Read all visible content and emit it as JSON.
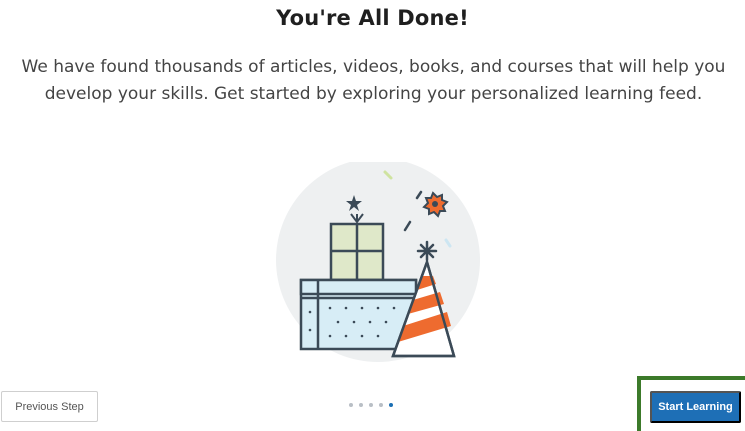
{
  "heading": {
    "title": "You're All Done!",
    "description": "We have found thousands of articles, videos, books, and courses that will help you develop your skills. Get started by exploring your personalized learning feed."
  },
  "illustration": {
    "icon": "celebration-illustration",
    "colors": {
      "circle": "#eef0f1",
      "gift_green": "#dfe8c9",
      "gift_blue": "#d7edf6",
      "party_hat_stripe": "#ee6b2f",
      "outline": "#3b4a57"
    }
  },
  "footer": {
    "previous_label": "Previous Step",
    "start_label": "Start Learning",
    "steps_total": 5,
    "current_step": 5
  },
  "colors": {
    "primary": "#1e6fb6",
    "highlight_box": "#3c7a2a"
  }
}
